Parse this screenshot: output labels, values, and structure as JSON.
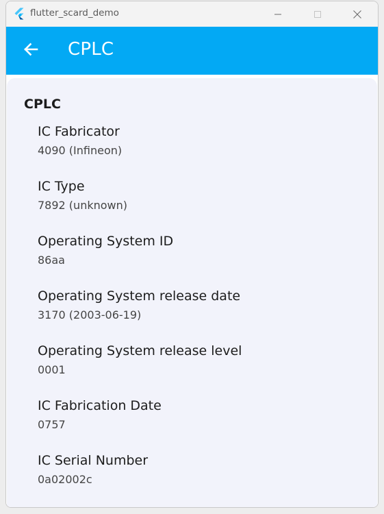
{
  "window": {
    "title": "flutter_scard_demo",
    "controls": [
      "minimize-icon",
      "maximize-icon",
      "close-icon"
    ]
  },
  "appbar": {
    "title": "CPLC",
    "back_icon": "arrow-left-icon",
    "color": "#03a9f4"
  },
  "section": {
    "title": "CPLC"
  },
  "items": [
    {
      "label": "IC Fabricator",
      "value": "4090 (Infineon)"
    },
    {
      "label": "IC Type",
      "value": "7892 (unknown)"
    },
    {
      "label": "Operating System ID",
      "value": "86aa"
    },
    {
      "label": "Operating System release date",
      "value": "3170 (2003-06-19)"
    },
    {
      "label": "Operating System release level",
      "value": "0001"
    },
    {
      "label": "IC Fabrication Date",
      "value": "0757"
    },
    {
      "label": "IC Serial Number",
      "value": "0a02002c"
    }
  ],
  "colors": {
    "card_background": "#f2f3fb",
    "text_primary": "#1c1c1c",
    "text_secondary": "#454545"
  }
}
